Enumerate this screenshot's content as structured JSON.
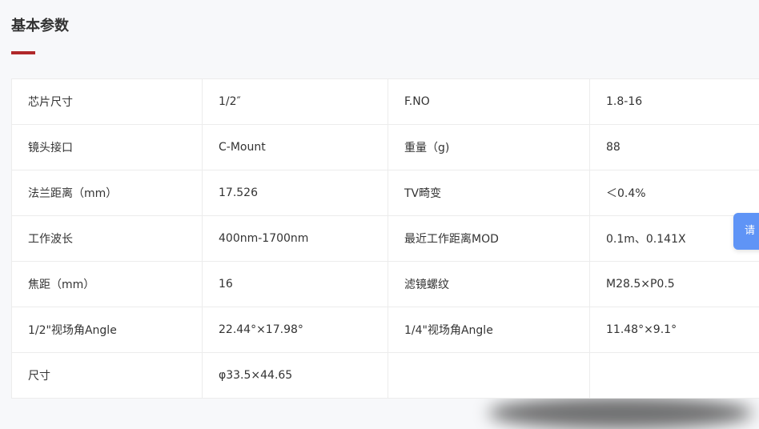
{
  "section": {
    "title": "基本参数",
    "accent_color": "#b0282a"
  },
  "params": {
    "rows": [
      [
        "芯片尺寸",
        "1/2″",
        "F.NO",
        "1.8-16"
      ],
      [
        "镜头接口",
        "C-Mount",
        "重量（g)",
        "88"
      ],
      [
        "法兰距离（mm）",
        "17.526",
        "TV畸变",
        "＜0.4%"
      ],
      [
        "工作波长",
        "400nm-1700nm",
        "最近工作距离MOD",
        "0.1m、0.141X"
      ],
      [
        "焦距（mm）",
        "16",
        "滤镜螺纹",
        "M28.5×P0.5"
      ],
      [
        "1/2\"视场角Angle",
        "22.44°×17.98°",
        "1/4\"视场角Angle",
        "11.48°×9.1°"
      ],
      [
        "尺寸",
        "φ33.5×44.65",
        "",
        ""
      ]
    ]
  },
  "side_tab": {
    "label": "请",
    "color": "#5f94f6"
  }
}
